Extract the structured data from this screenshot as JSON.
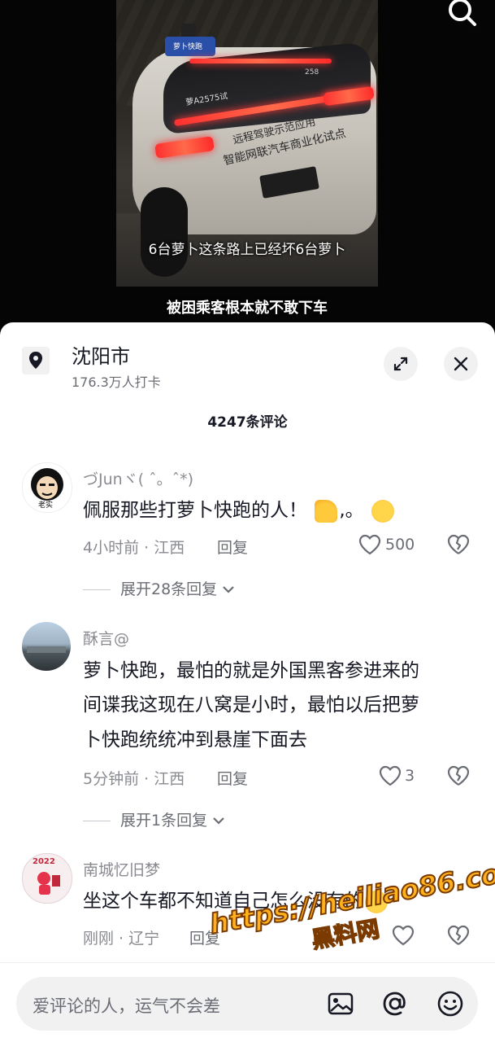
{
  "video": {
    "subtitle_top": "6台萝卜这条路上已经坏6台萝卜",
    "subtitle_bottom": "被困乘客根本就不敢下车",
    "car_text_line1": "远程驾驶示范应用",
    "car_text_line2": "智能网联汽车商业化试点",
    "car_plate_text": "萝A2575试",
    "car_number": "258",
    "roof_label": "萝卜快跑",
    "search_icon": "search-icon"
  },
  "location": {
    "title": "沈阳市",
    "subtitle": "176.3万人打卡",
    "icon": "location-pin-icon"
  },
  "comments_header": {
    "count_label": "4247条评论"
  },
  "comments": [
    {
      "username": "づJunヾ( ˆ。ˆ*)",
      "avatar_label": "老实",
      "text_lines": [
        "佩服那些打萝卜快跑的人！",
        ",。"
      ],
      "meta": "4小时前 · 江西",
      "reply_label": "回复",
      "likes": "500",
      "expand_label": "展开28条回复"
    },
    {
      "username": "酥言@",
      "text_lines": [
        "萝卜快跑，最怕的就是外国黑客参进来的",
        "间谍我这现在八窝是小时，最怕以后把萝",
        "卜快跑统统冲到悬崖下面去"
      ],
      "meta": "5分钟前 · 江西",
      "reply_label": "回复",
      "likes": "3",
      "expand_label": "展开1条回复"
    },
    {
      "username": "南城忆旧梦",
      "avatar_label": "2022",
      "text_lines": [
        "坐这个车都不知道自己怎么没有的"
      ],
      "meta": "刚刚 · 辽宁",
      "reply_label": "回复"
    }
  ],
  "input_bar": {
    "placeholder": "爱评论的人，运气不会差",
    "icons": [
      "image-icon",
      "at-icon",
      "emoji-icon"
    ]
  },
  "watermark": {
    "url": "https://heiliao86.com",
    "name": "黑料网"
  },
  "colors": {
    "text_primary": "#161823",
    "text_secondary": "#8a8b91",
    "watermark": "#ffb21c",
    "sheet_bg": "#ffffff"
  }
}
